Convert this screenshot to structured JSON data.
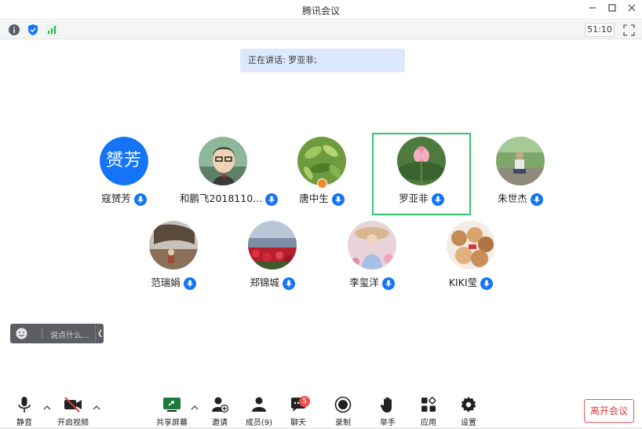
{
  "window": {
    "title": "腾讯会议",
    "controls": [
      "minimize-icon",
      "maximize-icon",
      "close-icon"
    ]
  },
  "infobar": {
    "icons": [
      "info-icon",
      "shield-icon",
      "signal-icon"
    ],
    "timer": "51:10"
  },
  "speaking": {
    "text": "正在讲话: 罗亚非;"
  },
  "participants": [
    {
      "name": "寇赟芳",
      "avatar_text": "赟芳",
      "avatar": "text"
    },
    {
      "name": "和鹏飞2018110...",
      "avatar": "cartoon"
    },
    {
      "name": "唐中生",
      "avatar": "plant",
      "host": true
    },
    {
      "name": "罗亚非",
      "avatar": "lotus",
      "speaking": true
    },
    {
      "name": "朱世杰",
      "avatar": "photo-person"
    },
    {
      "name": "范瑞娟",
      "avatar": "photo-tree"
    },
    {
      "name": "郑锦城",
      "avatar": "photo-flowers"
    },
    {
      "name": "李玺洋",
      "avatar": "photo-girl"
    },
    {
      "name": "KIKI莹",
      "avatar": "photo-bears"
    }
  ],
  "chat": {
    "placeholder": "说点什么..."
  },
  "toolbar": {
    "mute": "静音",
    "video": "开启视频",
    "share": "共享屏幕",
    "invite": "邀请",
    "members": "成员(9)",
    "chat": "聊天",
    "chat_badge": "5",
    "record": "录制",
    "raise_hand": "举手",
    "apps": "应用",
    "settings": "设置",
    "leave": "离开会议"
  },
  "colors": {
    "accent": "#1474f5",
    "speaker_frame": "#34c56f",
    "leave": "#e23b3b",
    "banner": "#dce8fb"
  }
}
